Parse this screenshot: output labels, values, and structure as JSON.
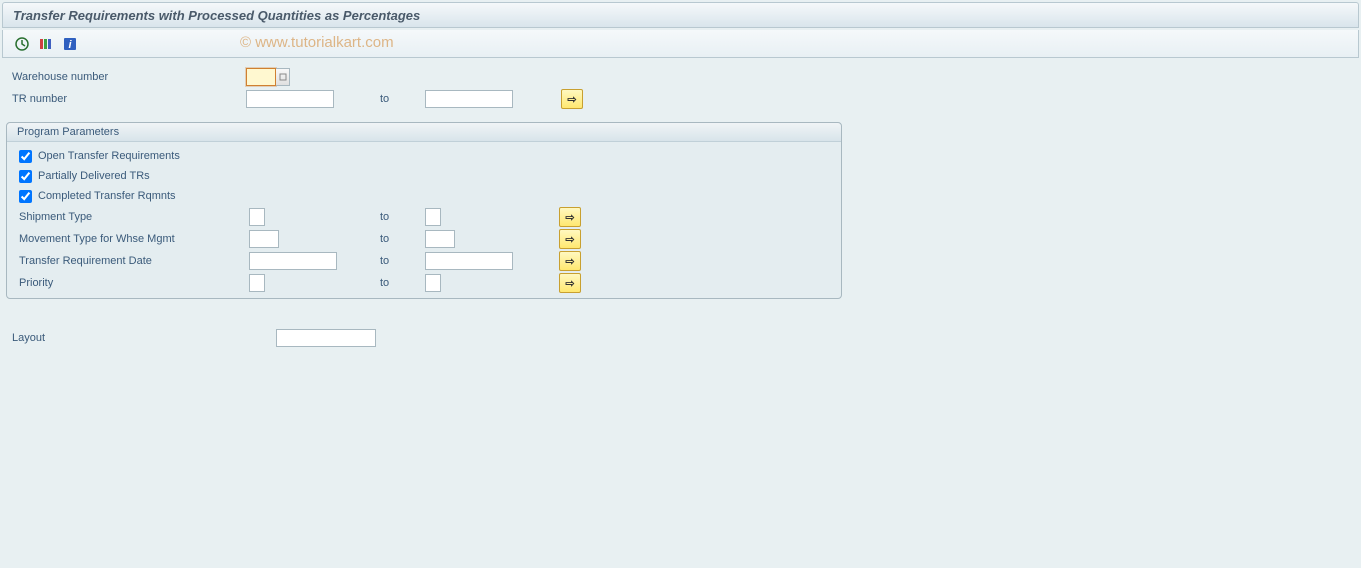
{
  "title": "Transfer Requirements with Processed Quantities as Percentages",
  "watermark": "© www.tutorialkart.com",
  "toolbar": {
    "icons": [
      "execute-icon",
      "variant-icon",
      "info-icon"
    ]
  },
  "fields": {
    "warehouse_number": {
      "label": "Warehouse number",
      "value": ""
    },
    "tr_number": {
      "label": "TR number",
      "from": "",
      "to_label": "to",
      "to": ""
    }
  },
  "group": {
    "title": "Program Parameters",
    "checkboxes": {
      "open_tr": {
        "label": "Open Transfer Requirements",
        "checked": true
      },
      "partial_tr": {
        "label": "Partially Delivered TRs",
        "checked": true
      },
      "completed_tr": {
        "label": "Completed Transfer Rqmnts",
        "checked": true
      }
    },
    "rows": {
      "shipment_type": {
        "label": "Shipment Type",
        "from": "",
        "to_label": "to",
        "to": ""
      },
      "movement_type": {
        "label": "Movement Type for Whse Mgmt",
        "from": "",
        "to_label": "to",
        "to": ""
      },
      "tr_date": {
        "label": "Transfer Requirement Date",
        "from": "",
        "to_label": "to",
        "to": ""
      },
      "priority": {
        "label": "Priority",
        "from": "",
        "to_label": "to",
        "to": ""
      }
    }
  },
  "layout": {
    "label": "Layout",
    "value": ""
  }
}
